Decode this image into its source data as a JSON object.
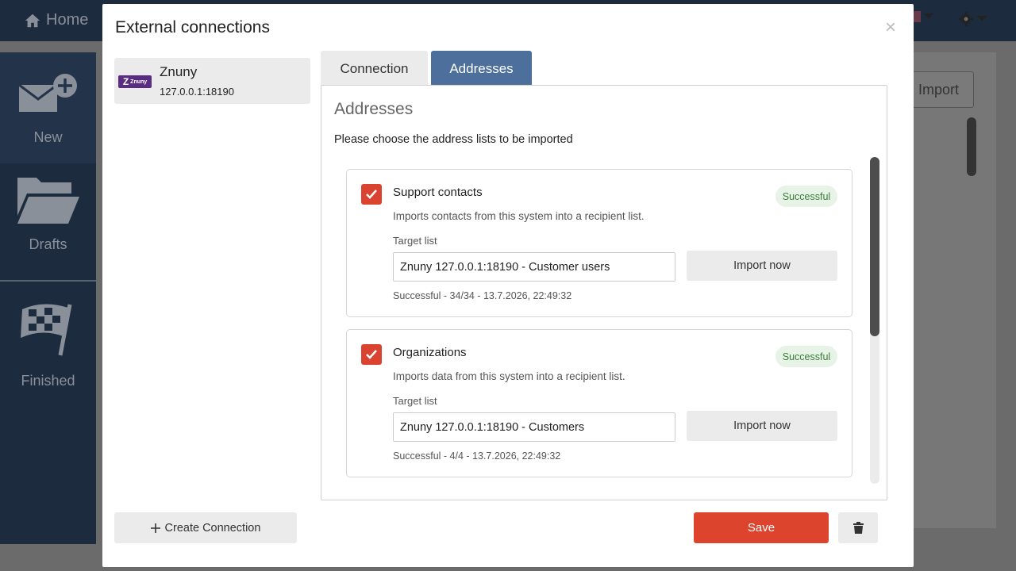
{
  "app": {
    "home_label": "Home",
    "sidebar": [
      {
        "label": "New"
      },
      {
        "label": "Drafts"
      },
      {
        "label": "Finished"
      }
    ],
    "bg_import_label": "Import"
  },
  "modal": {
    "title": "External connections",
    "close": "×",
    "connection": {
      "logo_text": "Znuny",
      "name": "Znuny",
      "address": "127.0.0.1:18190"
    },
    "tabs": [
      {
        "label": "Connection",
        "active": false
      },
      {
        "label": "Addresses",
        "active": true
      }
    ],
    "panel": {
      "title": "Addresses",
      "description": "Please choose the address lists to be imported",
      "cards": [
        {
          "title": "Support contacts",
          "checked": true,
          "badge": "Successful",
          "description": "Imports contacts from this system into a recipient list.",
          "target_label": "Target list",
          "target_value": "Znuny 127.0.0.1:18190 - Customer users",
          "import_label": "Import now",
          "status": "Successful - 34/34 - 13.7.2026, 22:49:32"
        },
        {
          "title": "Organizations",
          "checked": true,
          "badge": "Successful",
          "description": "Imports data from this system into a recipient list.",
          "target_label": "Target list",
          "target_value": "Znuny 127.0.0.1:18190 - Customers",
          "import_label": "Import now",
          "status": "Successful - 4/4 - 13.7.2026, 22:49:32"
        }
      ]
    },
    "footer": {
      "create_label": "Create Connection",
      "save_label": "Save"
    }
  },
  "colors": {
    "accent": "#4d6f9c",
    "danger": "#dd442d",
    "checkbox": "#d9432f",
    "success_bg": "#e6f3e6",
    "success_text": "#3a7d3a",
    "sidebar_bg": "#1c2b3e"
  },
  "icons": [
    "home-icon",
    "new-mail-icon",
    "folder-icon",
    "checkered-flag-icon",
    "flag-icon",
    "caret-down-icon",
    "gear-icon",
    "check-icon",
    "plus-icon",
    "trash-icon",
    "close-icon"
  ]
}
